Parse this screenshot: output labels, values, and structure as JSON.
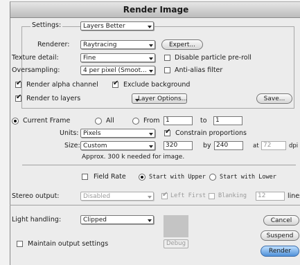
{
  "window": {
    "title": "Render Image"
  },
  "settings": {
    "label": "Settings:",
    "value": "Layers Better",
    "renderer_label": "Renderer:",
    "renderer_value": "Raytracing",
    "expert_button": "Expert...",
    "texture_label": "Texture detail:",
    "texture_value": "Fine",
    "disable_particle_label": "Disable particle pre-roll",
    "oversampling_label": "Oversampling:",
    "oversampling_value": "4 per pixel (Smoot...",
    "antialias_label": "Anti-alias filter",
    "render_alpha_label": "Render alpha channel",
    "exclude_background_label": "Exclude background",
    "render_layers_label": "Render to layers",
    "layer_options_button": "Layer Options...",
    "save_button": "Save..."
  },
  "frames": {
    "current_label": "Current Frame",
    "all_label": "All",
    "from_label": "From",
    "from_value": "1",
    "to_label": "to",
    "to_value": "1"
  },
  "size": {
    "units_label": "Units:",
    "units_value": "Pixels",
    "constrain_label": "Constrain proportions",
    "size_label": "Size:",
    "size_value": "Custom",
    "width_value": "320",
    "by_label": "by",
    "height_value": "240",
    "at_label": "at",
    "dpi_value": "72",
    "dpi_label": "dpi",
    "memory_note": "Approx. 300 k needed for image."
  },
  "fields": {
    "field_rate_label": "Field Rate",
    "start_upper_label": "Start with Upper",
    "start_lower_label": "Start with Lower"
  },
  "stereo": {
    "label": "Stereo output:",
    "value": "Disabled",
    "left_first_label": "Left First",
    "blanking_label": "Blanking",
    "lines_value": "12",
    "lines_label": "lines"
  },
  "light": {
    "label": "Light handling:",
    "value": "Clipped",
    "maintain_label": "Maintain output settings",
    "debug_button": "Debug"
  },
  "actions": {
    "cancel": "Cancel",
    "suspend": "Suspend",
    "render": "Render"
  },
  "colors": {
    "default_button": "#4f90d8",
    "window_bg": "#ececec",
    "swatch": "#c4c4c4"
  }
}
